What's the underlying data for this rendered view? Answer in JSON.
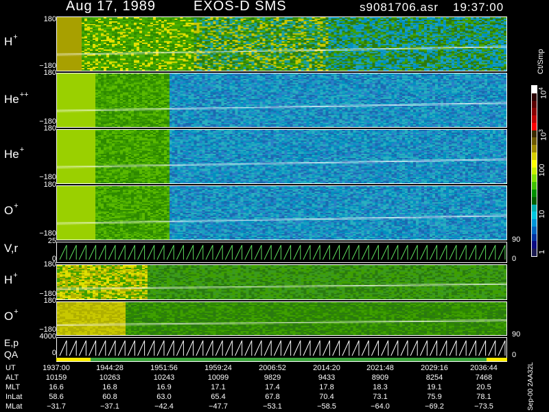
{
  "header": {
    "date": "Aug 17, 1989",
    "mission": "EXOS-D SMS",
    "file": "s9081706.asr",
    "time": "19:37:00"
  },
  "panels": [
    {
      "id": "h-plus",
      "species": "H",
      "charge": "+",
      "tick_top": "180",
      "tick_bottom": "−180",
      "tick_right": ""
    },
    {
      "id": "he-pp",
      "species": "He",
      "charge": "++",
      "tick_top": "180",
      "tick_bottom": "−180",
      "tick_right": ""
    },
    {
      "id": "he-plus",
      "species": "He",
      "charge": "+",
      "tick_top": "180",
      "tick_bottom": "−180",
      "tick_right": ""
    },
    {
      "id": "o-plus",
      "species": "O",
      "charge": "+",
      "tick_top": "180",
      "tick_bottom": "−180",
      "tick_right": ""
    },
    {
      "id": "vr",
      "species": "V,r",
      "charge": "",
      "tick_top": "25",
      "tick_bottom": "0",
      "tick_right_top": "90",
      "tick_right_bottom": "0"
    },
    {
      "id": "h-plus-2",
      "species": "H",
      "charge": "+",
      "tick_top": "180",
      "tick_bottom": "−180"
    },
    {
      "id": "o-plus-2",
      "species": "O",
      "charge": "+",
      "tick_top": "180",
      "tick_bottom": "−180"
    },
    {
      "id": "ep",
      "species": "E,p",
      "charge": "",
      "tick_top": "4000",
      "tick_bottom": "0",
      "tick_right_top": "90",
      "tick_right_bottom": "0"
    },
    {
      "id": "qa",
      "species": "QA",
      "charge": ""
    }
  ],
  "colorbar": {
    "unit": "Ct/Smp",
    "ticks": [
      "10",
      "10",
      "10",
      "100",
      "10",
      "1"
    ],
    "exp_labels": [
      "4",
      "3"
    ],
    "colors": [
      "#ffffff",
      "#2b0000",
      "#5a0000",
      "#8a0000",
      "#c00000",
      "#ff0000",
      "#3a2a00",
      "#6e5a00",
      "#a08a00",
      "#d8d000",
      "#ffff00",
      "#c8f000",
      "#80e000",
      "#3fc000",
      "#009000",
      "#006000",
      "#00b0b0",
      "#00c8e0",
      "#0096d8",
      "#0064c0",
      "#0032a0",
      "#0a0a80",
      "#1a1a50"
    ]
  },
  "table": {
    "row_labels": [
      "UT",
      "ALT",
      "MLT",
      "InLat",
      "MLat"
    ],
    "columns": [
      [
        "1937:00",
        "10159",
        "16.6",
        "58.6",
        "−31.7"
      ],
      [
        "1944:28",
        "10263",
        "16.8",
        "60.8",
        "−37.1"
      ],
      [
        "1951:56",
        "10243",
        "16.9",
        "63.0",
        "−42.4"
      ],
      [
        "1959:24",
        "10099",
        "17.1",
        "65.4",
        "−47.7"
      ],
      [
        "2006:52",
        "9829",
        "17.4",
        "67.8",
        "−53.1"
      ],
      [
        "2014:20",
        "9433",
        "17.8",
        "70.4",
        "−58.5"
      ],
      [
        "2021:48",
        "8909",
        "18.3",
        "73.1",
        "−64.0"
      ],
      [
        "2029:16",
        "8254",
        "19.1",
        "75.9",
        "−69.2"
      ],
      [
        "2036:44",
        "7468",
        "20.5",
        "78.1",
        "−73.5"
      ]
    ]
  },
  "footer_side": "Sep-00  2AA32L"
}
